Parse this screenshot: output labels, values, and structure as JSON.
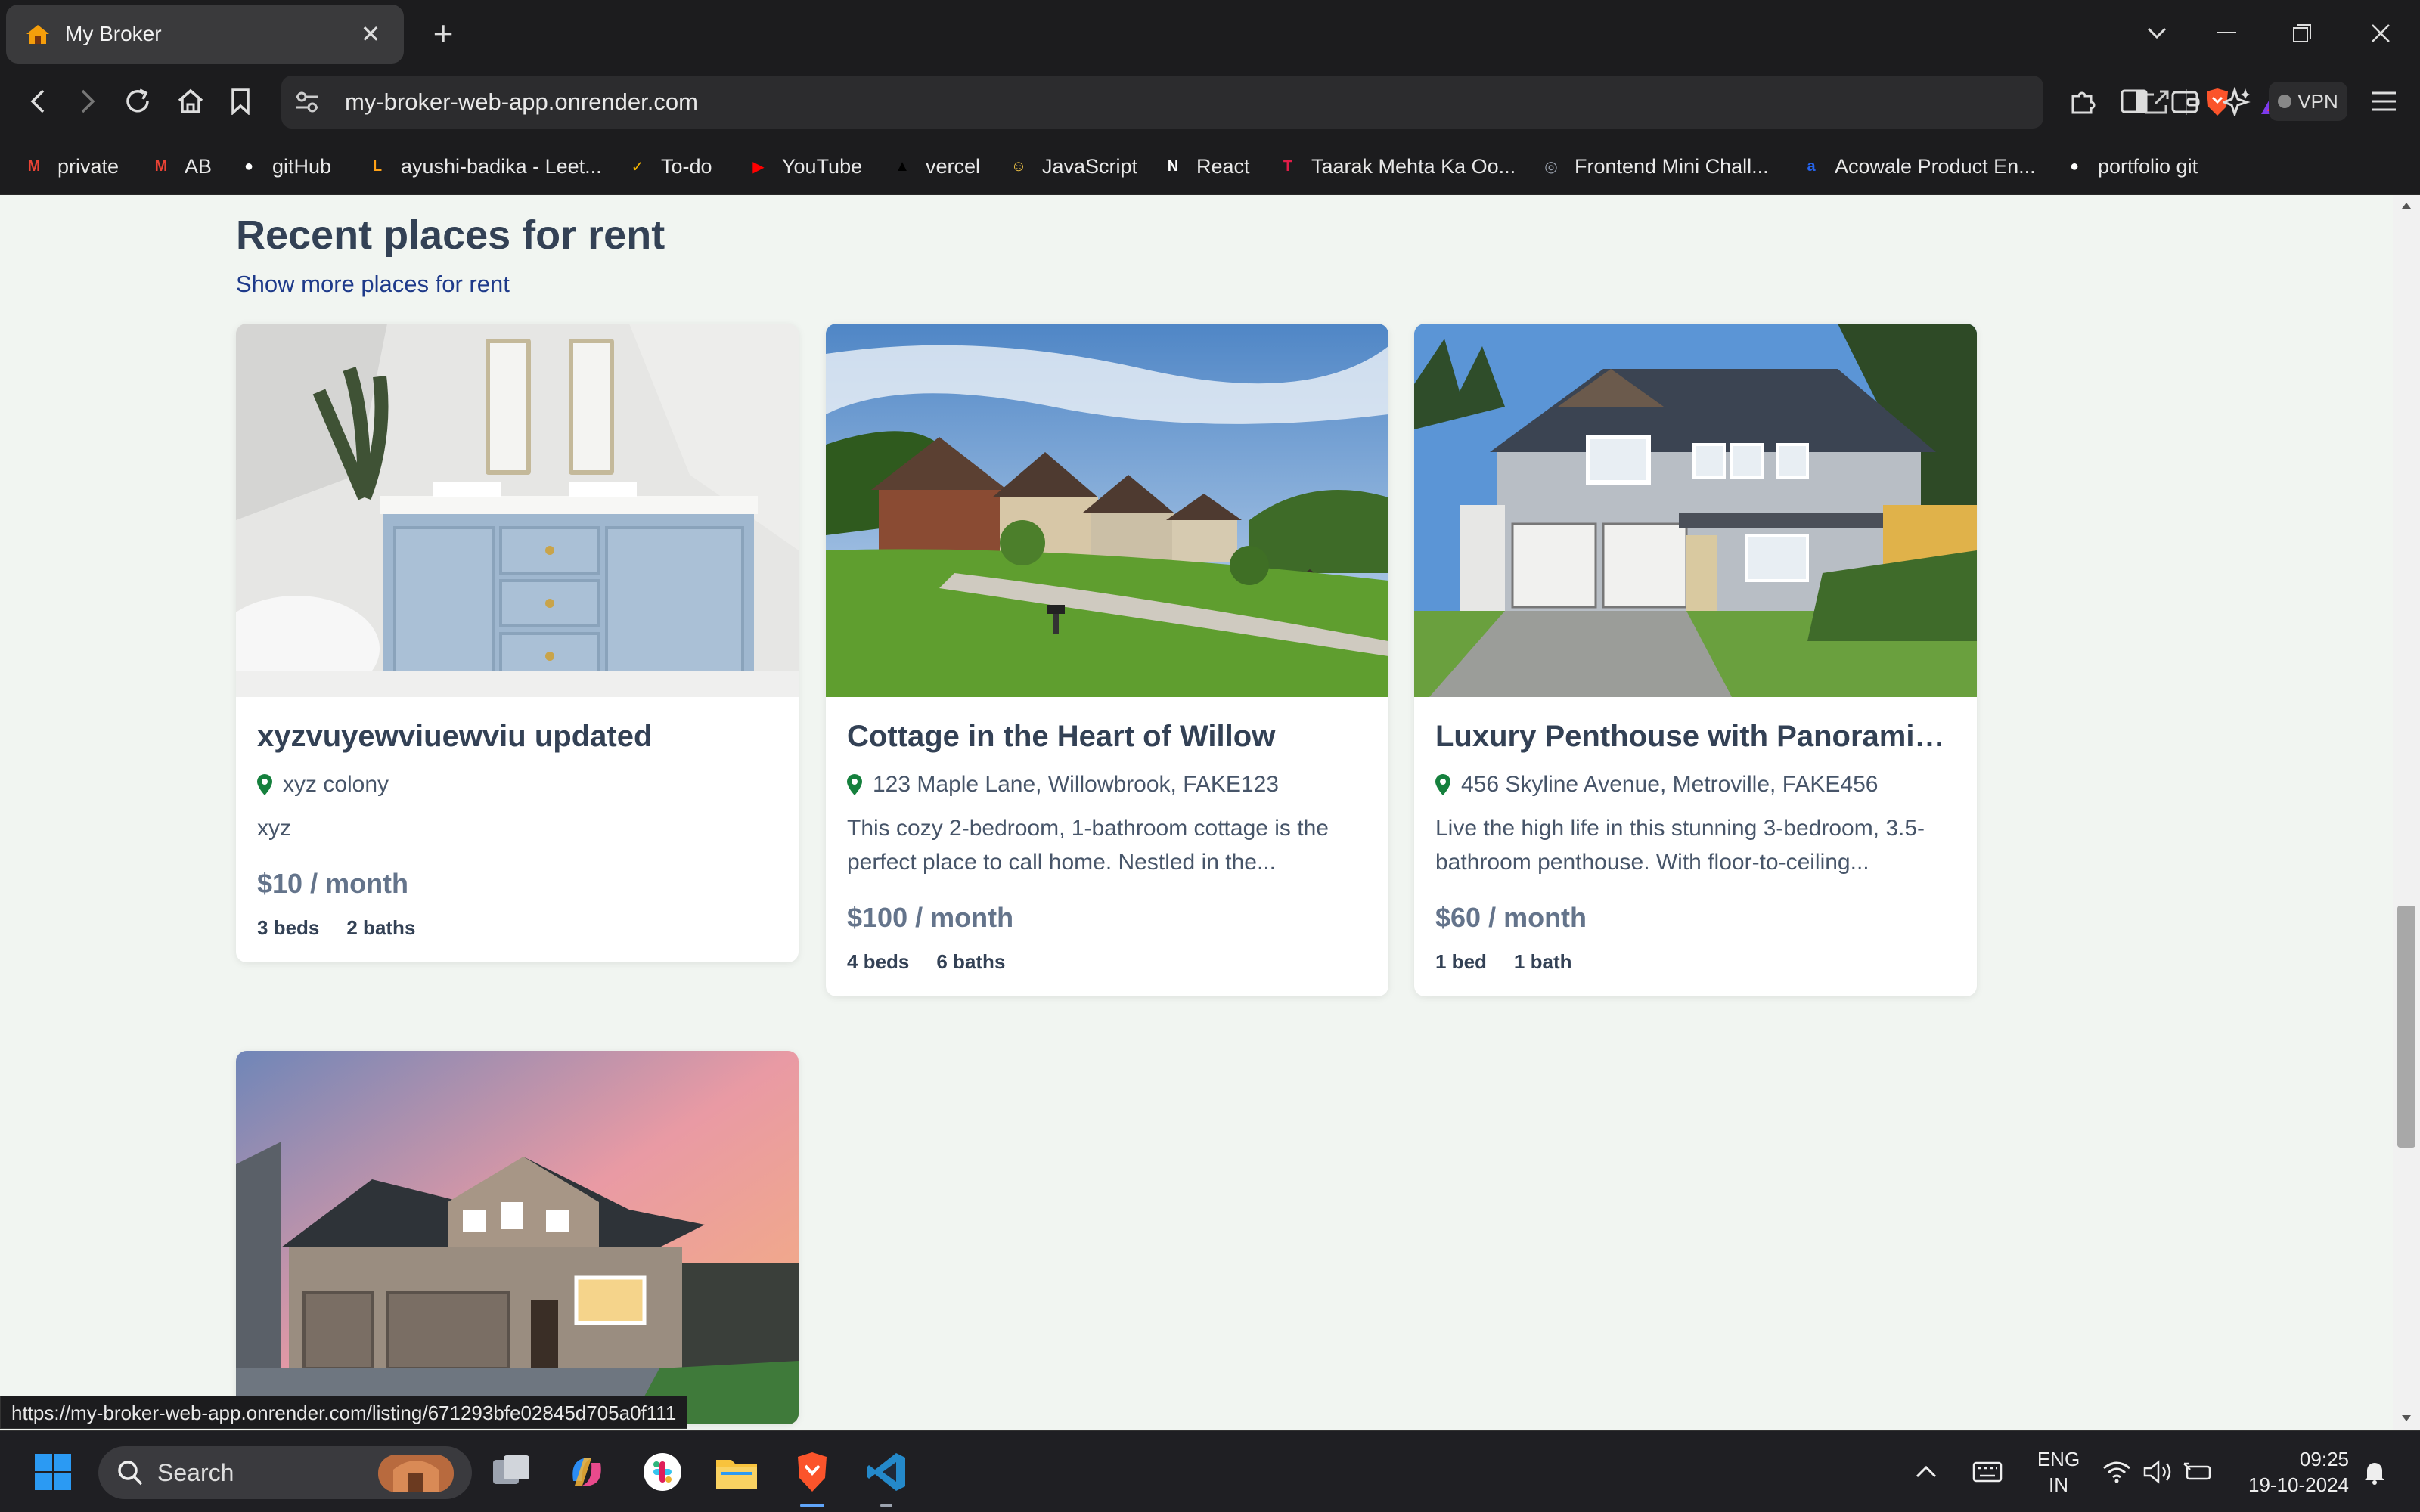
{
  "browser": {
    "tab_title": "My Broker",
    "url": "my-broker-web-app.onrender.com",
    "vpn_label": "VPN",
    "status_url": "https://my-broker-web-app.onrender.com/listing/671293bfe02845d705a0f111"
  },
  "bookmarks": [
    {
      "label": "private",
      "icon": "gmail-icon",
      "color": "#ea4335",
      "glyph": "M"
    },
    {
      "label": "AB",
      "icon": "gmail-icon",
      "color": "#ea4335",
      "glyph": "M"
    },
    {
      "label": "gitHub",
      "icon": "github-icon",
      "color": "#ffffff",
      "glyph": "●"
    },
    {
      "label": "ayushi-badika - Leet...",
      "icon": "leetcode-icon",
      "color": "#ffa116",
      "glyph": "L"
    },
    {
      "label": "To-do",
      "icon": "todo-icon",
      "color": "#f4b400",
      "glyph": "✓"
    },
    {
      "label": "YouTube",
      "icon": "youtube-icon",
      "color": "#ff0000",
      "glyph": "▶"
    },
    {
      "label": "vercel",
      "icon": "vercel-icon",
      "color": "#000000",
      "glyph": "▲"
    },
    {
      "label": "JavaScript",
      "icon": "smiley-icon",
      "color": "#f7c948",
      "glyph": "☺"
    },
    {
      "label": "React",
      "icon": "notion-icon",
      "color": "#ffffff",
      "glyph": "N"
    },
    {
      "label": "Taarak Mehta Ka Oo...",
      "icon": "tv-icon",
      "color": "#e11d48",
      "glyph": "T"
    },
    {
      "label": "Frontend Mini Chall...",
      "icon": "web-icon",
      "color": "#9ca3af",
      "glyph": "◎"
    },
    {
      "label": "Acowale Product En...",
      "icon": "acowale-icon",
      "color": "#2563eb",
      "glyph": "a"
    },
    {
      "label": "portfolio git",
      "icon": "github-icon",
      "color": "#ffffff",
      "glyph": "●"
    }
  ],
  "page": {
    "heading": "Recent places for rent",
    "show_more": "Show more places for rent"
  },
  "listings": [
    {
      "title": "xyzvuyewviuewviu updated",
      "location": "xyz colony",
      "description": "xyz",
      "price": "$10 / month",
      "beds": "3 beds",
      "baths": "2 baths"
    },
    {
      "title": "Cottage in the Heart of Willow",
      "location": "123 Maple Lane, Willowbrook, FAKE123",
      "description": "This cozy 2-bedroom, 1-bathroom cottage is the perfect place to call home. Nestled in the...",
      "price": "$100 / month",
      "beds": "4 beds",
      "baths": "6 baths"
    },
    {
      "title": "Luxury Penthouse with Panoramic ...",
      "location": "456 Skyline Avenue, Metroville, FAKE456",
      "description": "Live the high life in this stunning 3-bedroom, 3.5-bathroom penthouse. With floor-to-ceiling...",
      "price": "$60 / month",
      "beds": "1 bed",
      "baths": "1 bath"
    }
  ],
  "taskbar": {
    "search_placeholder": "Search",
    "lang_top": "ENG",
    "lang_bottom": "IN",
    "time": "09:25",
    "date": "19-10-2024"
  },
  "colors": {
    "accent": "#1e3a8a",
    "location_pin": "#15803d",
    "heading": "#334155"
  }
}
